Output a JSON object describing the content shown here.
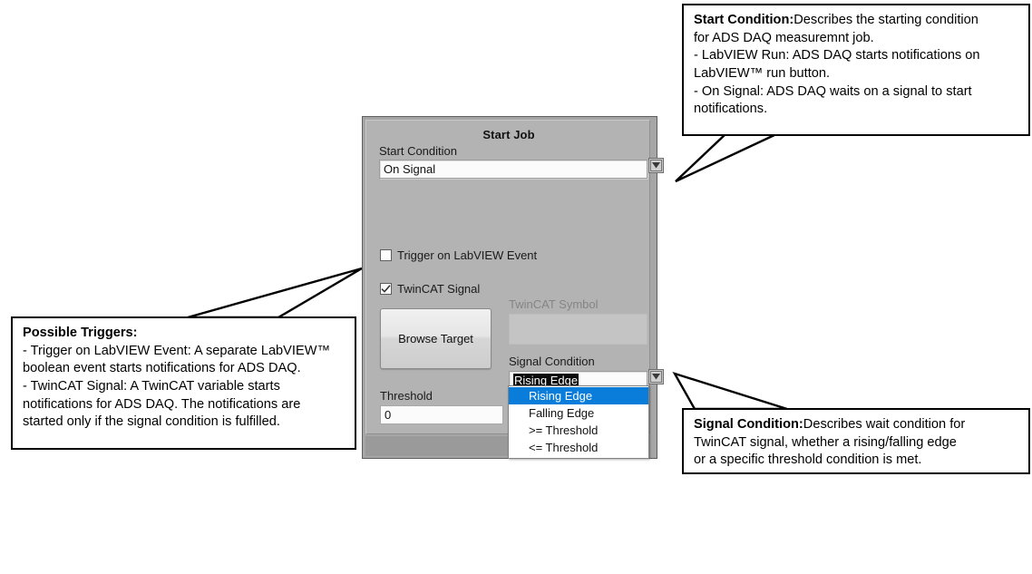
{
  "dialog": {
    "title": "Start Job",
    "start_condition": {
      "label": "Start Condition",
      "value": "On Signal",
      "dropdown_icon": "chevron-down-icon"
    },
    "checkboxes": [
      {
        "label": "Trigger on LabVIEW Event",
        "checked": false
      },
      {
        "label": "TwinCAT Signal",
        "checked": true
      }
    ],
    "browse_button": {
      "label": "Browse Target"
    },
    "twincat_symbol": {
      "label": "TwinCAT Symbol",
      "value": ""
    },
    "signal_condition": {
      "label": "Signal Condition",
      "value": "Rising Edge",
      "dropdown_icon": "chevron-down-icon",
      "options": [
        {
          "label": "Rising Edge",
          "selected": true
        },
        {
          "label": "Falling Edge",
          "selected": false
        },
        {
          "label": ">= Threshold",
          "selected": false
        },
        {
          "label": "<= Threshold",
          "selected": false
        }
      ]
    },
    "threshold": {
      "label": "Threshold",
      "value": "0"
    }
  },
  "callouts": {
    "start_condition": {
      "title": "Start Condition:",
      "body_line1": "Describes the starting condition",
      "body_line2": "for ADS DAQ measuremnt job.",
      "body_line3": "- LabVIEW Run: ADS DAQ starts notifications on",
      "body_line4": "LabVIEW™ run button.",
      "body_line5": "- On Signal: ADS DAQ waits on a signal to start",
      "body_line6": "notifications."
    },
    "possible_triggers": {
      "title": "Possible Triggers:",
      "body_line1": "- Trigger on LabVIEW Event: A separate LabVIEW™",
      "body_line2": "boolean event starts notifications for ADS DAQ.",
      "body_line3": "- TwinCAT Signal: A TwinCAT variable starts",
      "body_line4": "notifications for ADS DAQ. The notifications are",
      "body_line5": "started only if the signal condition is fulfilled."
    },
    "signal_condition": {
      "title": "Signal Condition:",
      "body_line1": "Describes wait condition for",
      "body_line2": "TwinCAT signal, whether a rising/falling edge",
      "body_line3": "or a specific threshold condition is met."
    }
  },
  "colors": {
    "panel_bg": "#b3b3b3",
    "selection_blue": "#0a7ddb",
    "callout_border": "#000000"
  }
}
